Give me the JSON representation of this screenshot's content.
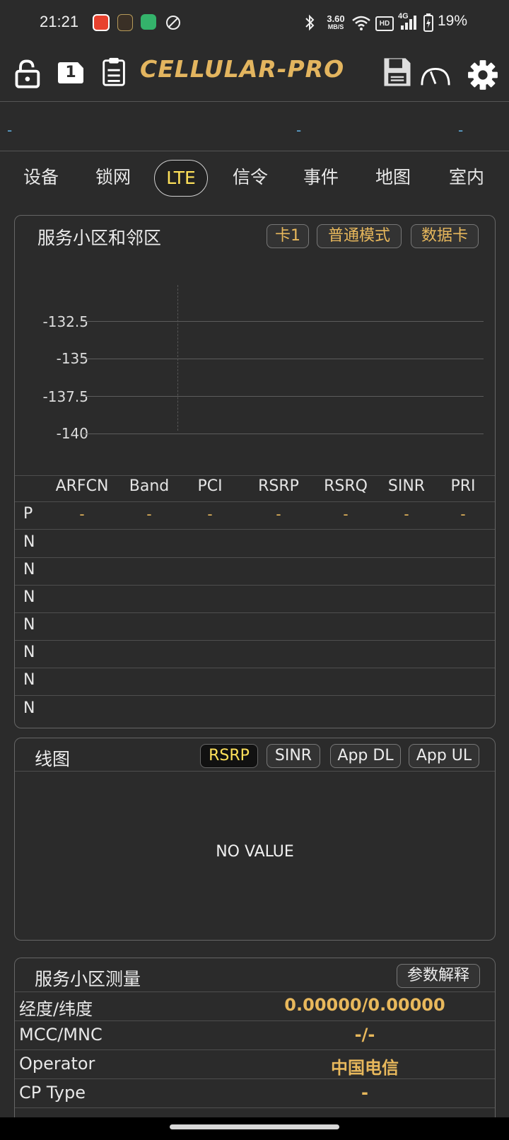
{
  "status_bar": {
    "time": "21:21",
    "net_speed_value": "3.60",
    "net_speed_unit": "MB/S",
    "hd_label": "HD",
    "network_type": "4G",
    "battery_percent": "19%",
    "icons": [
      "app-red-icon",
      "app-gold-icon",
      "shield-icon",
      "no-sync-icon",
      "bluetooth-icon",
      "wifi-icon",
      "signal-icon",
      "battery-icon"
    ]
  },
  "toolbar": {
    "logo": "CELLULAR-PRO",
    "sim_badge": "1",
    "icons": [
      "lock-open-icon",
      "sim-card-icon",
      "clipboard-icon",
      "floppy-disk-icon",
      "speedometer-icon",
      "gear-icon"
    ],
    "accent_color": "#e3b55f"
  },
  "info_row": {
    "left": "-",
    "middle": "-",
    "right": "-"
  },
  "tabs": [
    {
      "label": "设备",
      "active": false
    },
    {
      "label": "锁网",
      "active": false
    },
    {
      "label": "LTE",
      "active": true
    },
    {
      "label": "信令",
      "active": false
    },
    {
      "label": "事件",
      "active": false
    },
    {
      "label": "地图",
      "active": false
    },
    {
      "label": "室内",
      "active": false
    }
  ],
  "serving_panel": {
    "title": "服务小区和邻区",
    "chips": [
      "卡1",
      "普通模式",
      "数据卡"
    ],
    "chart_data": {
      "type": "bar",
      "categories": [],
      "values": [],
      "y_ticks": [
        "-132.5",
        "-135",
        "-137.5",
        "-140"
      ],
      "ylim": [
        -140,
        -132.5
      ],
      "grid": true
    },
    "table": {
      "columns": [
        "ARFCN",
        "Band",
        "PCI",
        "RSRP",
        "RSRQ",
        "SINR",
        "PRI"
      ],
      "rows": [
        {
          "label": "P",
          "cells": [
            "-",
            "-",
            "-",
            "-",
            "-",
            "-",
            "-"
          ]
        },
        {
          "label": "N",
          "cells": []
        },
        {
          "label": "N",
          "cells": []
        },
        {
          "label": "N",
          "cells": []
        },
        {
          "label": "N",
          "cells": []
        },
        {
          "label": "N",
          "cells": []
        },
        {
          "label": "N",
          "cells": []
        },
        {
          "label": "N",
          "cells": []
        }
      ]
    }
  },
  "line_panel": {
    "title": "线图",
    "buttons": [
      {
        "label": "RSRP",
        "selected": true
      },
      {
        "label": "SINR",
        "selected": false
      },
      {
        "label": "App DL",
        "selected": false
      },
      {
        "label": "App UL",
        "selected": false
      }
    ],
    "empty_text": "NO VALUE"
  },
  "measure_panel": {
    "title": "服务小区测量",
    "help_button": "参数解释",
    "rows": [
      {
        "label": "经度/纬度",
        "value": "0.00000/0.00000"
      },
      {
        "label": "MCC/MNC",
        "value": "-/-"
      },
      {
        "label": "Operator",
        "value": "中国电信"
      },
      {
        "label": "CP Type",
        "value": "-"
      }
    ]
  }
}
